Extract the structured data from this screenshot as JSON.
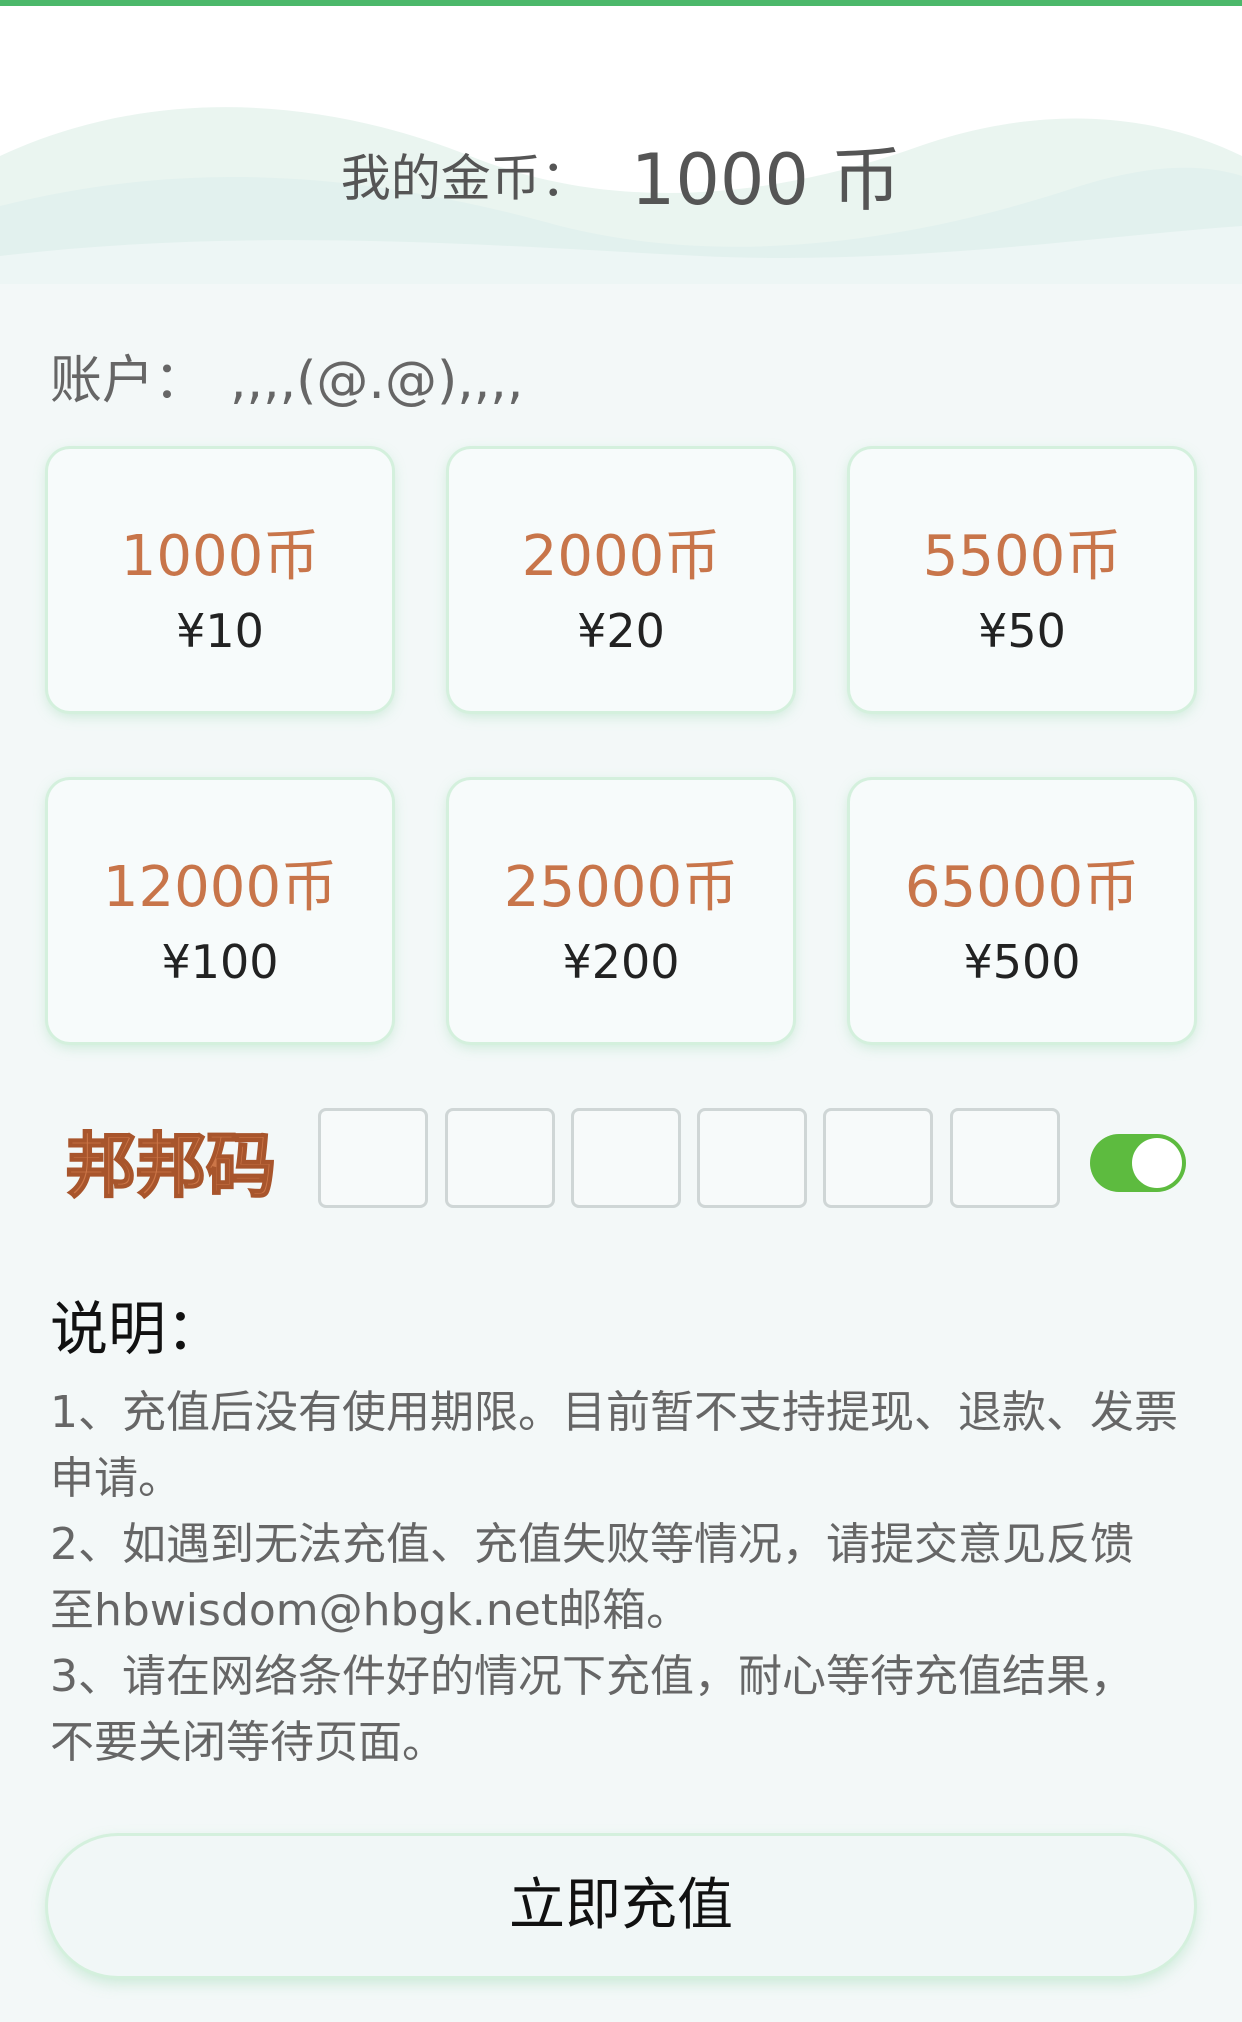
{
  "header": {
    "balance_label": "我的金币：",
    "balance_value": "1000 币"
  },
  "account": {
    "label": "账户：",
    "name": ",,,,(@.@),,,,"
  },
  "packages": [
    {
      "coins": "1000币",
      "price": "¥10"
    },
    {
      "coins": "2000币",
      "price": "¥20"
    },
    {
      "coins": "5500币",
      "price": "¥50"
    },
    {
      "coins": "12000币",
      "price": "¥100"
    },
    {
      "coins": "25000币",
      "price": "¥200"
    },
    {
      "coins": "65000币",
      "price": "¥500"
    }
  ],
  "code": {
    "label": "邦邦码",
    "toggle_on": true
  },
  "notes": {
    "title": "说明：",
    "lines": [
      "1、充值后没有使用期限。目前暂不支持提现、退款、发票",
      "申请。",
      "2、如遇到无法充值、充值失败等情况，请提交意见反馈",
      "至hbwisdom@hbgk.net邮箱。",
      "3、请在网络条件好的情况下充值，耐心等待充值结果，",
      "不要关闭等待页面。"
    ]
  },
  "submit_label": "立即充值",
  "colors": {
    "accent_green": "#4cb86a",
    "coin_orange": "#c8754a",
    "toggle_green": "#5dbb3f"
  }
}
